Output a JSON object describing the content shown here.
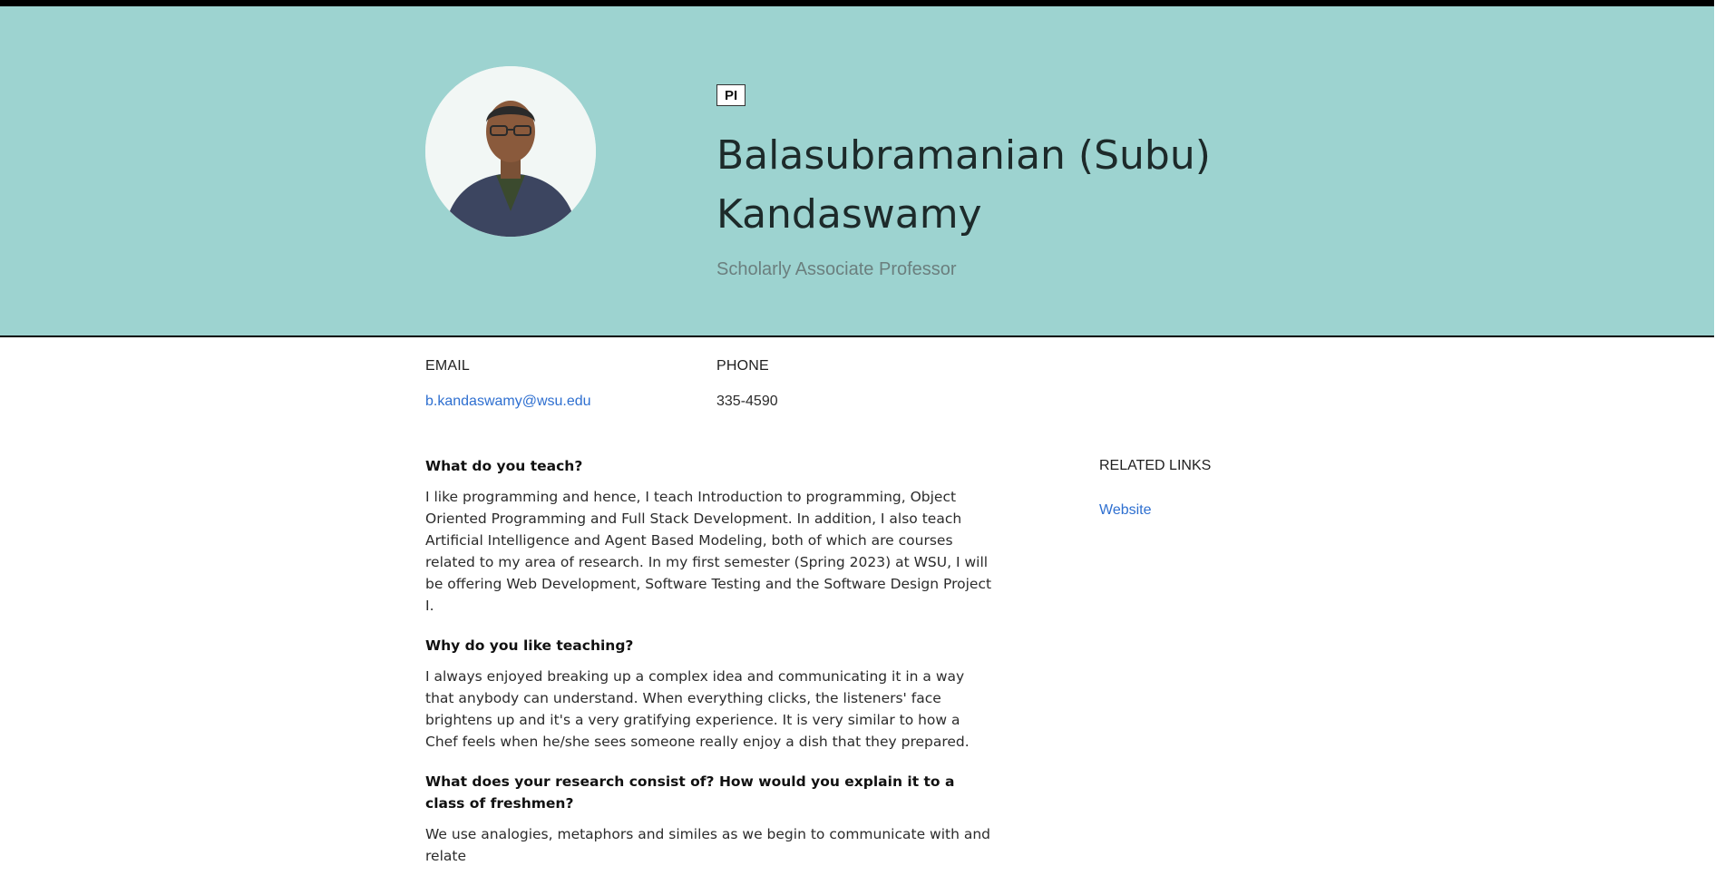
{
  "header": {
    "badge": "PI",
    "name": "Balasubramanian (Subu) Kandaswamy",
    "role": "Scholarly Associate Professor",
    "accent_color": "#9dd3d0"
  },
  "contact": {
    "email_label": "EMAIL",
    "email_value": "b.kandaswamy@wsu.edu",
    "phone_label": "PHONE",
    "phone_value": "335-4590"
  },
  "content": [
    {
      "question": "What do you teach?",
      "answer": "I like programming and hence, I teach Introduction to programming, Object Oriented Programming and Full Stack Development. In addition, I also teach Artificial Intelligence and Agent Based Modeling, both of which are courses related to my area of research. In my first semester (Spring 2023) at WSU, I will be offering Web Development, Software Testing and the Software Design Project I."
    },
    {
      "question": "Why do you like teaching?",
      "answer": "I always enjoyed breaking up a complex idea and communicating it in a way that anybody can understand. When everything clicks, the listeners' face brightens up and it's a very gratifying experience. It is very similar to how a Chef feels when he/she sees someone really enjoy a dish that they prepared."
    },
    {
      "question": "What does your research consist of? How would you explain it to a class of freshmen?",
      "answer": "We use analogies, metaphors and similes as we begin to communicate with and relate"
    }
  ],
  "related": {
    "title": "RELATED LINKS",
    "links": [
      {
        "label": "Website"
      }
    ]
  }
}
